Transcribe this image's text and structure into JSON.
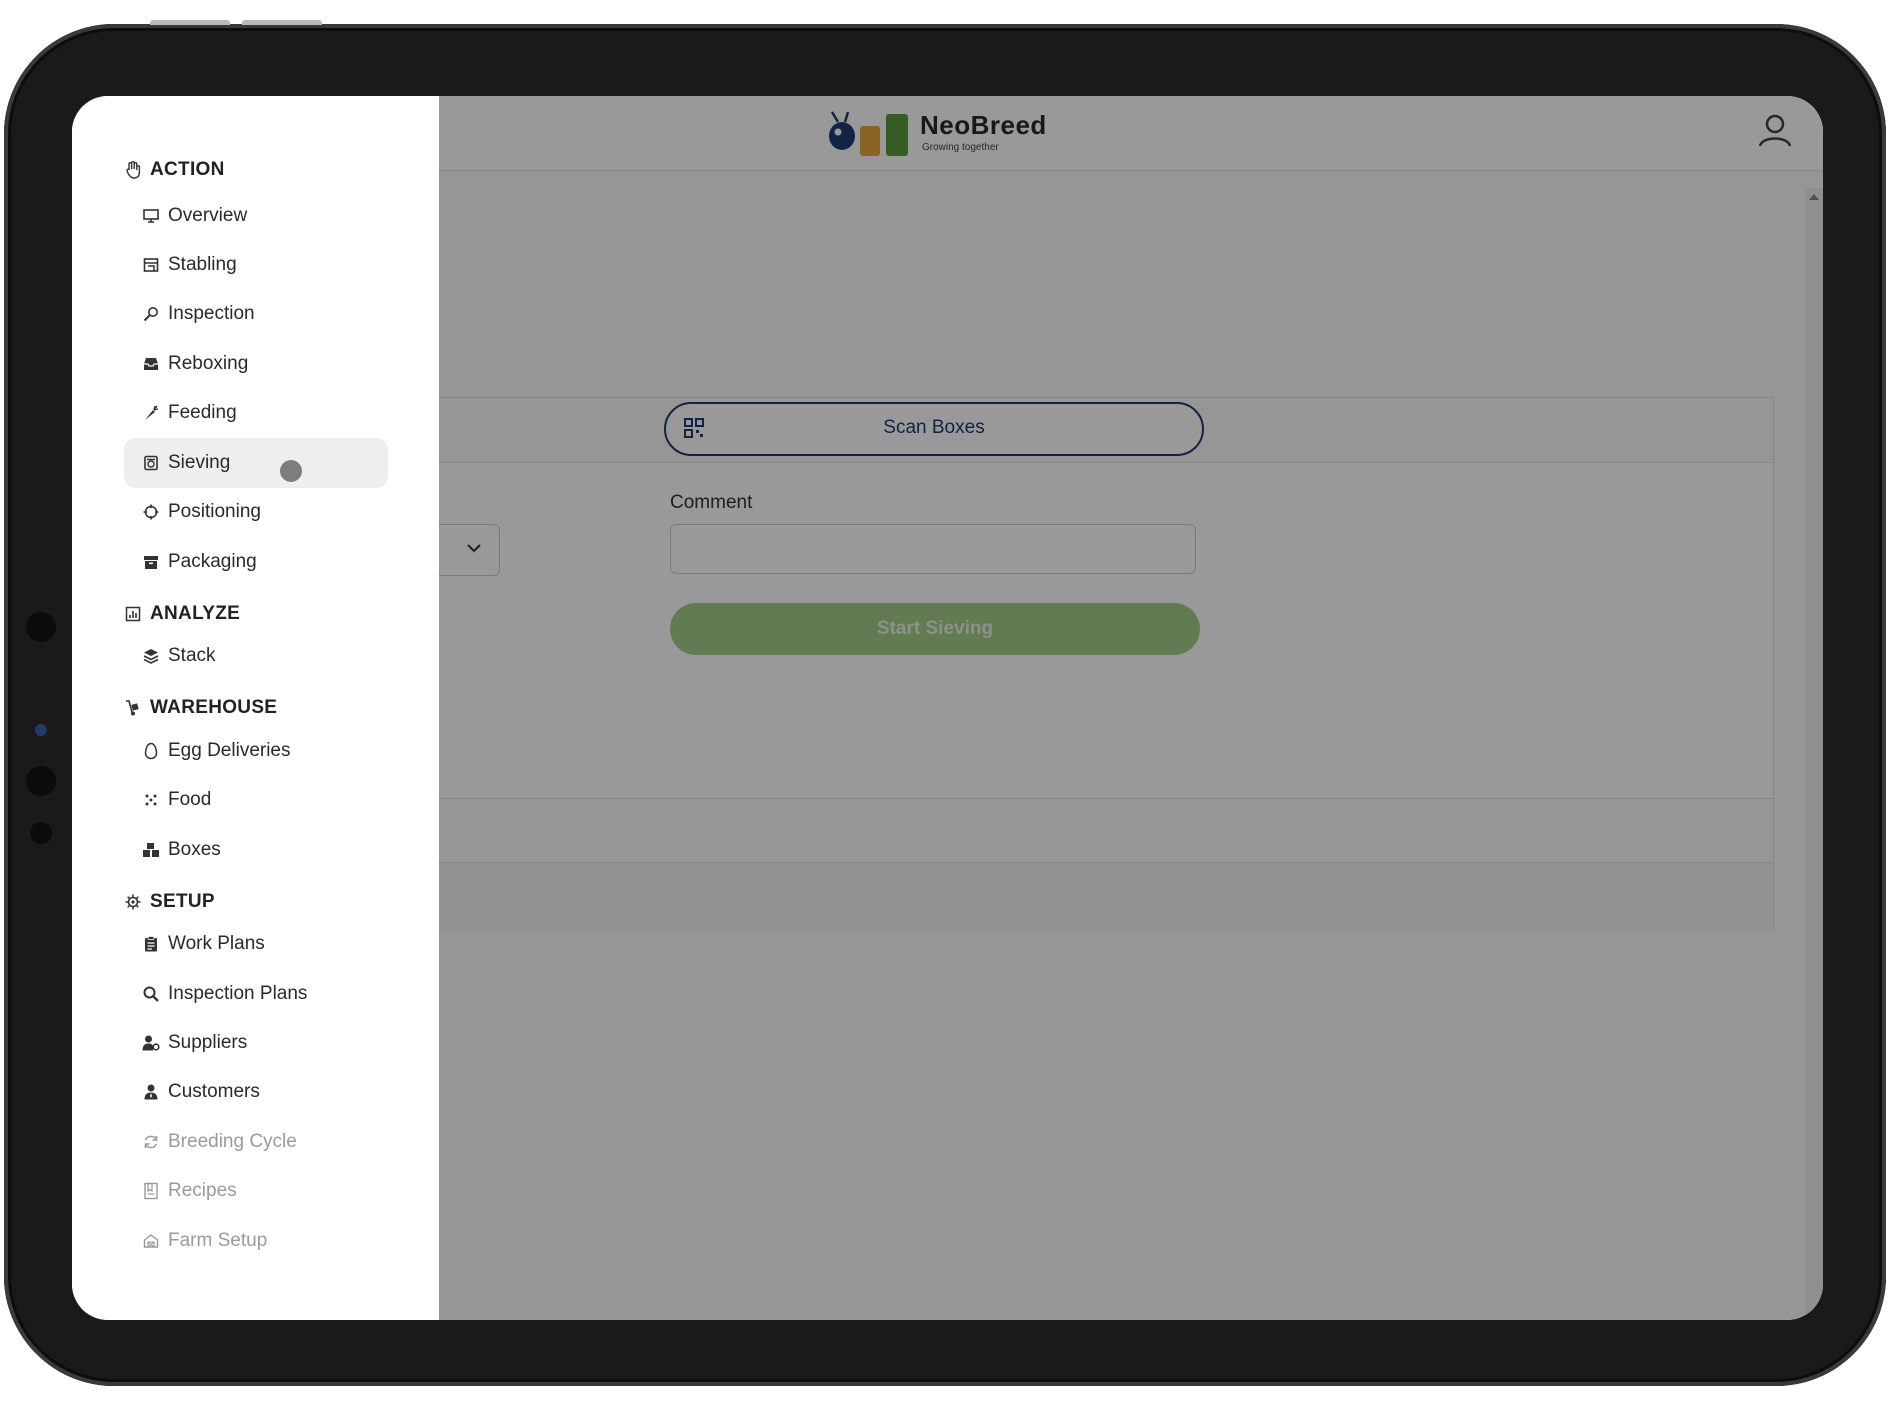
{
  "header": {
    "brand_name": "NeoBreed",
    "brand_tagline": "Growing together",
    "user_icon": "user-icon"
  },
  "main": {
    "scan_button_label": "Scan Boxes",
    "comment_label": "Comment",
    "comment_value": "",
    "start_button_label": "Start Sieving"
  },
  "colors": {
    "primary": "#1f3b73",
    "accent_green": "#a3cd8b",
    "overlay": "rgba(0,0,0,0.40)"
  },
  "sidebar": {
    "sections": [
      {
        "title": "ACTION",
        "icon": "hand-icon",
        "items": [
          {
            "label": "Overview",
            "icon": "monitor-icon"
          },
          {
            "label": "Stabling",
            "icon": "stable-icon"
          },
          {
            "label": "Inspection",
            "icon": "magnifier-icon"
          },
          {
            "label": "Reboxing",
            "icon": "inbox-icon"
          },
          {
            "label": "Feeding",
            "icon": "carrot-icon"
          },
          {
            "label": "Sieving",
            "icon": "sieve-icon",
            "active": true
          },
          {
            "label": "Positioning",
            "icon": "crosshair-icon"
          },
          {
            "label": "Packaging",
            "icon": "box-icon"
          }
        ]
      },
      {
        "title": "ANALYZE",
        "icon": "chart-icon",
        "items": [
          {
            "label": "Stack",
            "icon": "layers-icon"
          }
        ]
      },
      {
        "title": "WAREHOUSE",
        "icon": "dolly-icon",
        "items": [
          {
            "label": "Egg Deliveries",
            "icon": "egg-icon"
          },
          {
            "label": "Food",
            "icon": "dots-icon"
          },
          {
            "label": "Boxes",
            "icon": "boxes-icon"
          }
        ]
      },
      {
        "title": "SETUP",
        "icon": "gear-icon",
        "items": [
          {
            "label": "Work Plans",
            "icon": "clipboard-icon"
          },
          {
            "label": "Inspection Plans",
            "icon": "search-icon"
          },
          {
            "label": "Suppliers",
            "icon": "user-gear-icon"
          },
          {
            "label": "Customers",
            "icon": "user-tie-icon"
          },
          {
            "label": "Breeding Cycle",
            "icon": "cycle-icon",
            "disabled": true
          },
          {
            "label": "Recipes",
            "icon": "recipe-icon",
            "disabled": true
          },
          {
            "label": "Farm Setup",
            "icon": "farm-icon",
            "disabled": true
          }
        ]
      }
    ]
  }
}
